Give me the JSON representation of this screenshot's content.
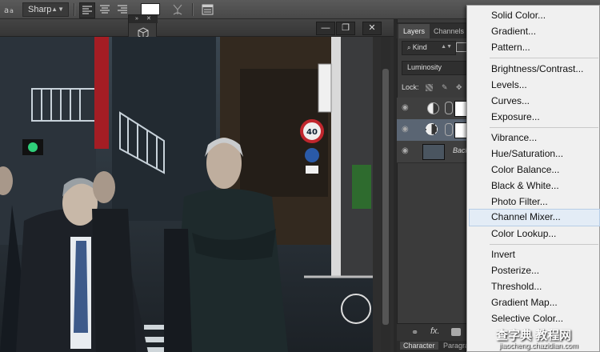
{
  "options_bar": {
    "aa_icon": "aa-text-icon",
    "antialias_value": "Sharp",
    "align_icons": [
      "align-left-icon",
      "align-center-icon",
      "align-right-icon"
    ],
    "text_color": "#ffffff",
    "warp_icon": "warp-text-icon",
    "panels_icon": "character-panel-icon"
  },
  "document_window": {
    "buttons": [
      "minimize-icon",
      "restore-icon",
      "close-icon"
    ],
    "close_glyph": "✕",
    "minimize_glyph": "—",
    "restore_glyph": "❐"
  },
  "layers_panel": {
    "tabs": [
      "Layers",
      "Channels"
    ],
    "filter_kind": "Kind",
    "blend_mode": "Luminosity",
    "lock_label": "Lock:",
    "layers": [
      {
        "type": "adjustment",
        "selected": false
      },
      {
        "type": "adjustment",
        "selected": true
      },
      {
        "type": "pixel",
        "name": "Back"
      }
    ],
    "bottom_icons": [
      "link-layers-icon",
      "fx-icon",
      "add-mask-icon",
      "adjustment-layer-icon"
    ],
    "fx_label": "fx.",
    "lower_tabs": [
      "Character",
      "Paragraph"
    ]
  },
  "adjustment_menu": {
    "highlighted": "Channel Mixer...",
    "groups": [
      [
        "Solid Color...",
        "Gradient...",
        "Pattern..."
      ],
      [
        "Brightness/Contrast...",
        "Levels...",
        "Curves...",
        "Exposure..."
      ],
      [
        "Vibrance...",
        "Hue/Saturation...",
        "Color Balance...",
        "Black & White...",
        "Photo Filter...",
        "Channel Mixer...",
        "Color Lookup..."
      ],
      [
        "Invert",
        "Posterize...",
        "Threshold...",
        "Gradient Map...",
        "Selective Color..."
      ]
    ]
  },
  "watermark": {
    "line1": "查字典 教程网",
    "line2": "jiaocheng.chazidian.com"
  },
  "photo": {
    "sign_speed": "40"
  }
}
